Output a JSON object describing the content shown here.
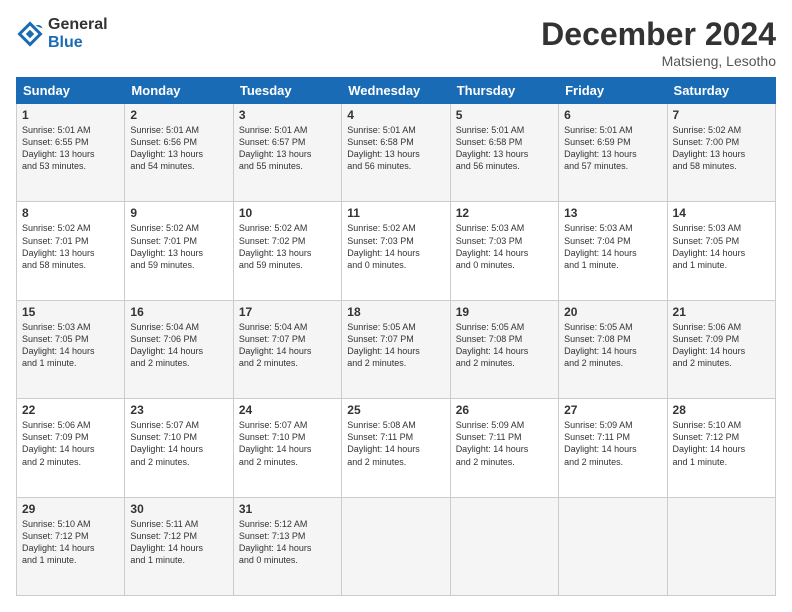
{
  "logo": {
    "line1": "General",
    "line2": "Blue"
  },
  "header": {
    "title": "December 2024",
    "location": "Matsieng, Lesotho"
  },
  "days_of_week": [
    "Sunday",
    "Monday",
    "Tuesday",
    "Wednesday",
    "Thursday",
    "Friday",
    "Saturday"
  ],
  "weeks": [
    [
      {
        "day": "1",
        "content": "Sunrise: 5:01 AM\nSunset: 6:55 PM\nDaylight: 13 hours\nand 53 minutes."
      },
      {
        "day": "2",
        "content": "Sunrise: 5:01 AM\nSunset: 6:56 PM\nDaylight: 13 hours\nand 54 minutes."
      },
      {
        "day": "3",
        "content": "Sunrise: 5:01 AM\nSunset: 6:57 PM\nDaylight: 13 hours\nand 55 minutes."
      },
      {
        "day": "4",
        "content": "Sunrise: 5:01 AM\nSunset: 6:58 PM\nDaylight: 13 hours\nand 56 minutes."
      },
      {
        "day": "5",
        "content": "Sunrise: 5:01 AM\nSunset: 6:58 PM\nDaylight: 13 hours\nand 56 minutes."
      },
      {
        "day": "6",
        "content": "Sunrise: 5:01 AM\nSunset: 6:59 PM\nDaylight: 13 hours\nand 57 minutes."
      },
      {
        "day": "7",
        "content": "Sunrise: 5:02 AM\nSunset: 7:00 PM\nDaylight: 13 hours\nand 58 minutes."
      }
    ],
    [
      {
        "day": "8",
        "content": "Sunrise: 5:02 AM\nSunset: 7:01 PM\nDaylight: 13 hours\nand 58 minutes."
      },
      {
        "day": "9",
        "content": "Sunrise: 5:02 AM\nSunset: 7:01 PM\nDaylight: 13 hours\nand 59 minutes."
      },
      {
        "day": "10",
        "content": "Sunrise: 5:02 AM\nSunset: 7:02 PM\nDaylight: 13 hours\nand 59 minutes."
      },
      {
        "day": "11",
        "content": "Sunrise: 5:02 AM\nSunset: 7:03 PM\nDaylight: 14 hours\nand 0 minutes."
      },
      {
        "day": "12",
        "content": "Sunrise: 5:03 AM\nSunset: 7:03 PM\nDaylight: 14 hours\nand 0 minutes."
      },
      {
        "day": "13",
        "content": "Sunrise: 5:03 AM\nSunset: 7:04 PM\nDaylight: 14 hours\nand 1 minute."
      },
      {
        "day": "14",
        "content": "Sunrise: 5:03 AM\nSunset: 7:05 PM\nDaylight: 14 hours\nand 1 minute."
      }
    ],
    [
      {
        "day": "15",
        "content": "Sunrise: 5:03 AM\nSunset: 7:05 PM\nDaylight: 14 hours\nand 1 minute."
      },
      {
        "day": "16",
        "content": "Sunrise: 5:04 AM\nSunset: 7:06 PM\nDaylight: 14 hours\nand 2 minutes."
      },
      {
        "day": "17",
        "content": "Sunrise: 5:04 AM\nSunset: 7:07 PM\nDaylight: 14 hours\nand 2 minutes."
      },
      {
        "day": "18",
        "content": "Sunrise: 5:05 AM\nSunset: 7:07 PM\nDaylight: 14 hours\nand 2 minutes."
      },
      {
        "day": "19",
        "content": "Sunrise: 5:05 AM\nSunset: 7:08 PM\nDaylight: 14 hours\nand 2 minutes."
      },
      {
        "day": "20",
        "content": "Sunrise: 5:05 AM\nSunset: 7:08 PM\nDaylight: 14 hours\nand 2 minutes."
      },
      {
        "day": "21",
        "content": "Sunrise: 5:06 AM\nSunset: 7:09 PM\nDaylight: 14 hours\nand 2 minutes."
      }
    ],
    [
      {
        "day": "22",
        "content": "Sunrise: 5:06 AM\nSunset: 7:09 PM\nDaylight: 14 hours\nand 2 minutes."
      },
      {
        "day": "23",
        "content": "Sunrise: 5:07 AM\nSunset: 7:10 PM\nDaylight: 14 hours\nand 2 minutes."
      },
      {
        "day": "24",
        "content": "Sunrise: 5:07 AM\nSunset: 7:10 PM\nDaylight: 14 hours\nand 2 minutes."
      },
      {
        "day": "25",
        "content": "Sunrise: 5:08 AM\nSunset: 7:11 PM\nDaylight: 14 hours\nand 2 minutes."
      },
      {
        "day": "26",
        "content": "Sunrise: 5:09 AM\nSunset: 7:11 PM\nDaylight: 14 hours\nand 2 minutes."
      },
      {
        "day": "27",
        "content": "Sunrise: 5:09 AM\nSunset: 7:11 PM\nDaylight: 14 hours\nand 2 minutes."
      },
      {
        "day": "28",
        "content": "Sunrise: 5:10 AM\nSunset: 7:12 PM\nDaylight: 14 hours\nand 1 minute."
      }
    ],
    [
      {
        "day": "29",
        "content": "Sunrise: 5:10 AM\nSunset: 7:12 PM\nDaylight: 14 hours\nand 1 minute."
      },
      {
        "day": "30",
        "content": "Sunrise: 5:11 AM\nSunset: 7:12 PM\nDaylight: 14 hours\nand 1 minute."
      },
      {
        "day": "31",
        "content": "Sunrise: 5:12 AM\nSunset: 7:13 PM\nDaylight: 14 hours\nand 0 minutes."
      },
      {
        "day": "",
        "content": ""
      },
      {
        "day": "",
        "content": ""
      },
      {
        "day": "",
        "content": ""
      },
      {
        "day": "",
        "content": ""
      }
    ]
  ]
}
